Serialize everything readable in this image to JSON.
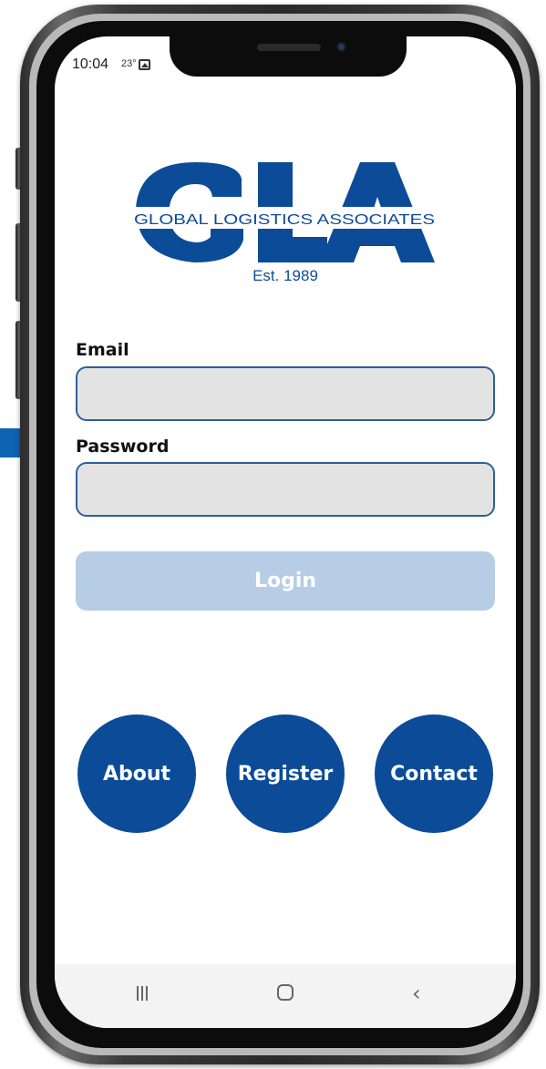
{
  "status_bar": {
    "time": "10:04",
    "temperature": "23°"
  },
  "logo": {
    "letters": "GLA",
    "tagline": "GLOBAL LOGISTICS ASSOCIATES",
    "established": "Est. 1989",
    "brand_color": "#0c4b97"
  },
  "form": {
    "email_label": "Email",
    "email_value": "",
    "password_label": "Password",
    "password_value": "",
    "login_label": "Login"
  },
  "actions": {
    "about_label": "About",
    "register_label": "Register",
    "contact_label": "Contact"
  },
  "nav": {
    "recent_icon": "recent-apps-icon",
    "home_icon": "home-icon",
    "back_icon": "back-icon"
  },
  "colors": {
    "primary": "#0c4b97",
    "login_disabled": "#b7cde6",
    "input_background": "#e3e3e3",
    "input_border": "#2f5f9a"
  }
}
